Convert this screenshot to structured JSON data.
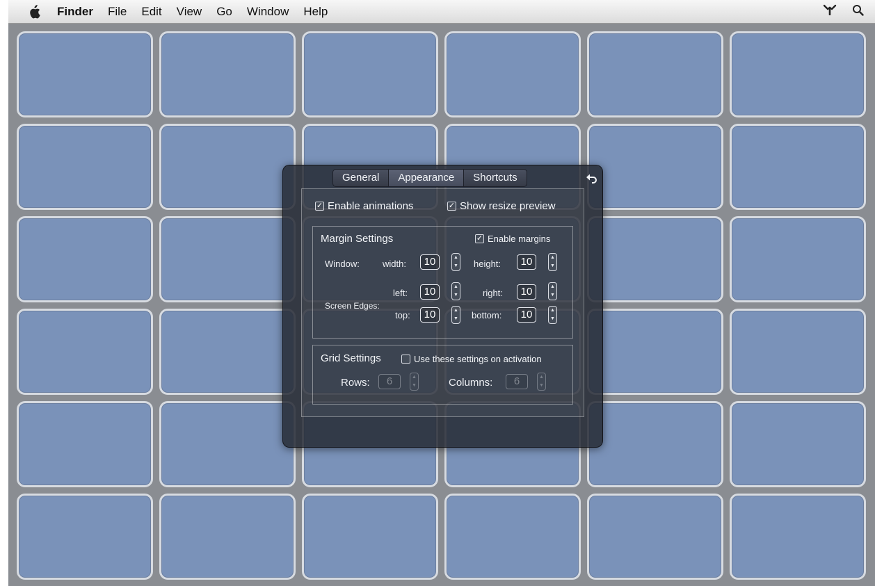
{
  "menubar": {
    "app_name": "Finder",
    "menus": [
      "File",
      "Edit",
      "View",
      "Go",
      "Window",
      "Help"
    ],
    "right_icons": [
      "app-tree-icon",
      "search-icon"
    ]
  },
  "grid": {
    "rows": 6,
    "columns": 6
  },
  "panel": {
    "tabs": [
      "General",
      "Appearance",
      "Shortcuts"
    ],
    "active_tab": "Appearance",
    "enable_animations": {
      "label": "Enable animations",
      "checked": true
    },
    "show_resize_preview": {
      "label": "Show resize preview",
      "checked": true
    },
    "margin_settings": {
      "title": "Margin Settings",
      "enable_margins": {
        "label": "Enable margins",
        "checked": true
      },
      "window_label": "Window:",
      "width_label": "width:",
      "width_value": "10",
      "height_label": "height:",
      "height_value": "10",
      "screen_edges_label": "Screen Edges:",
      "left_label": "left:",
      "left_value": "10",
      "right_label": "right:",
      "right_value": "10",
      "top_label": "top:",
      "top_value": "10",
      "bottom_label": "bottom:",
      "bottom_value": "10"
    },
    "grid_settings": {
      "title": "Grid Settings",
      "use_on_activation": {
        "label": "Use these settings on activation",
        "checked": false
      },
      "rows_label": "Rows:",
      "rows_value": "6",
      "columns_label": "Columns:",
      "columns_value": "6"
    }
  },
  "colors": {
    "desktop": "#8a8d92",
    "cell_fill": "#7a92b9",
    "cell_border": "#d7dbe1",
    "panel": "#262b36"
  }
}
